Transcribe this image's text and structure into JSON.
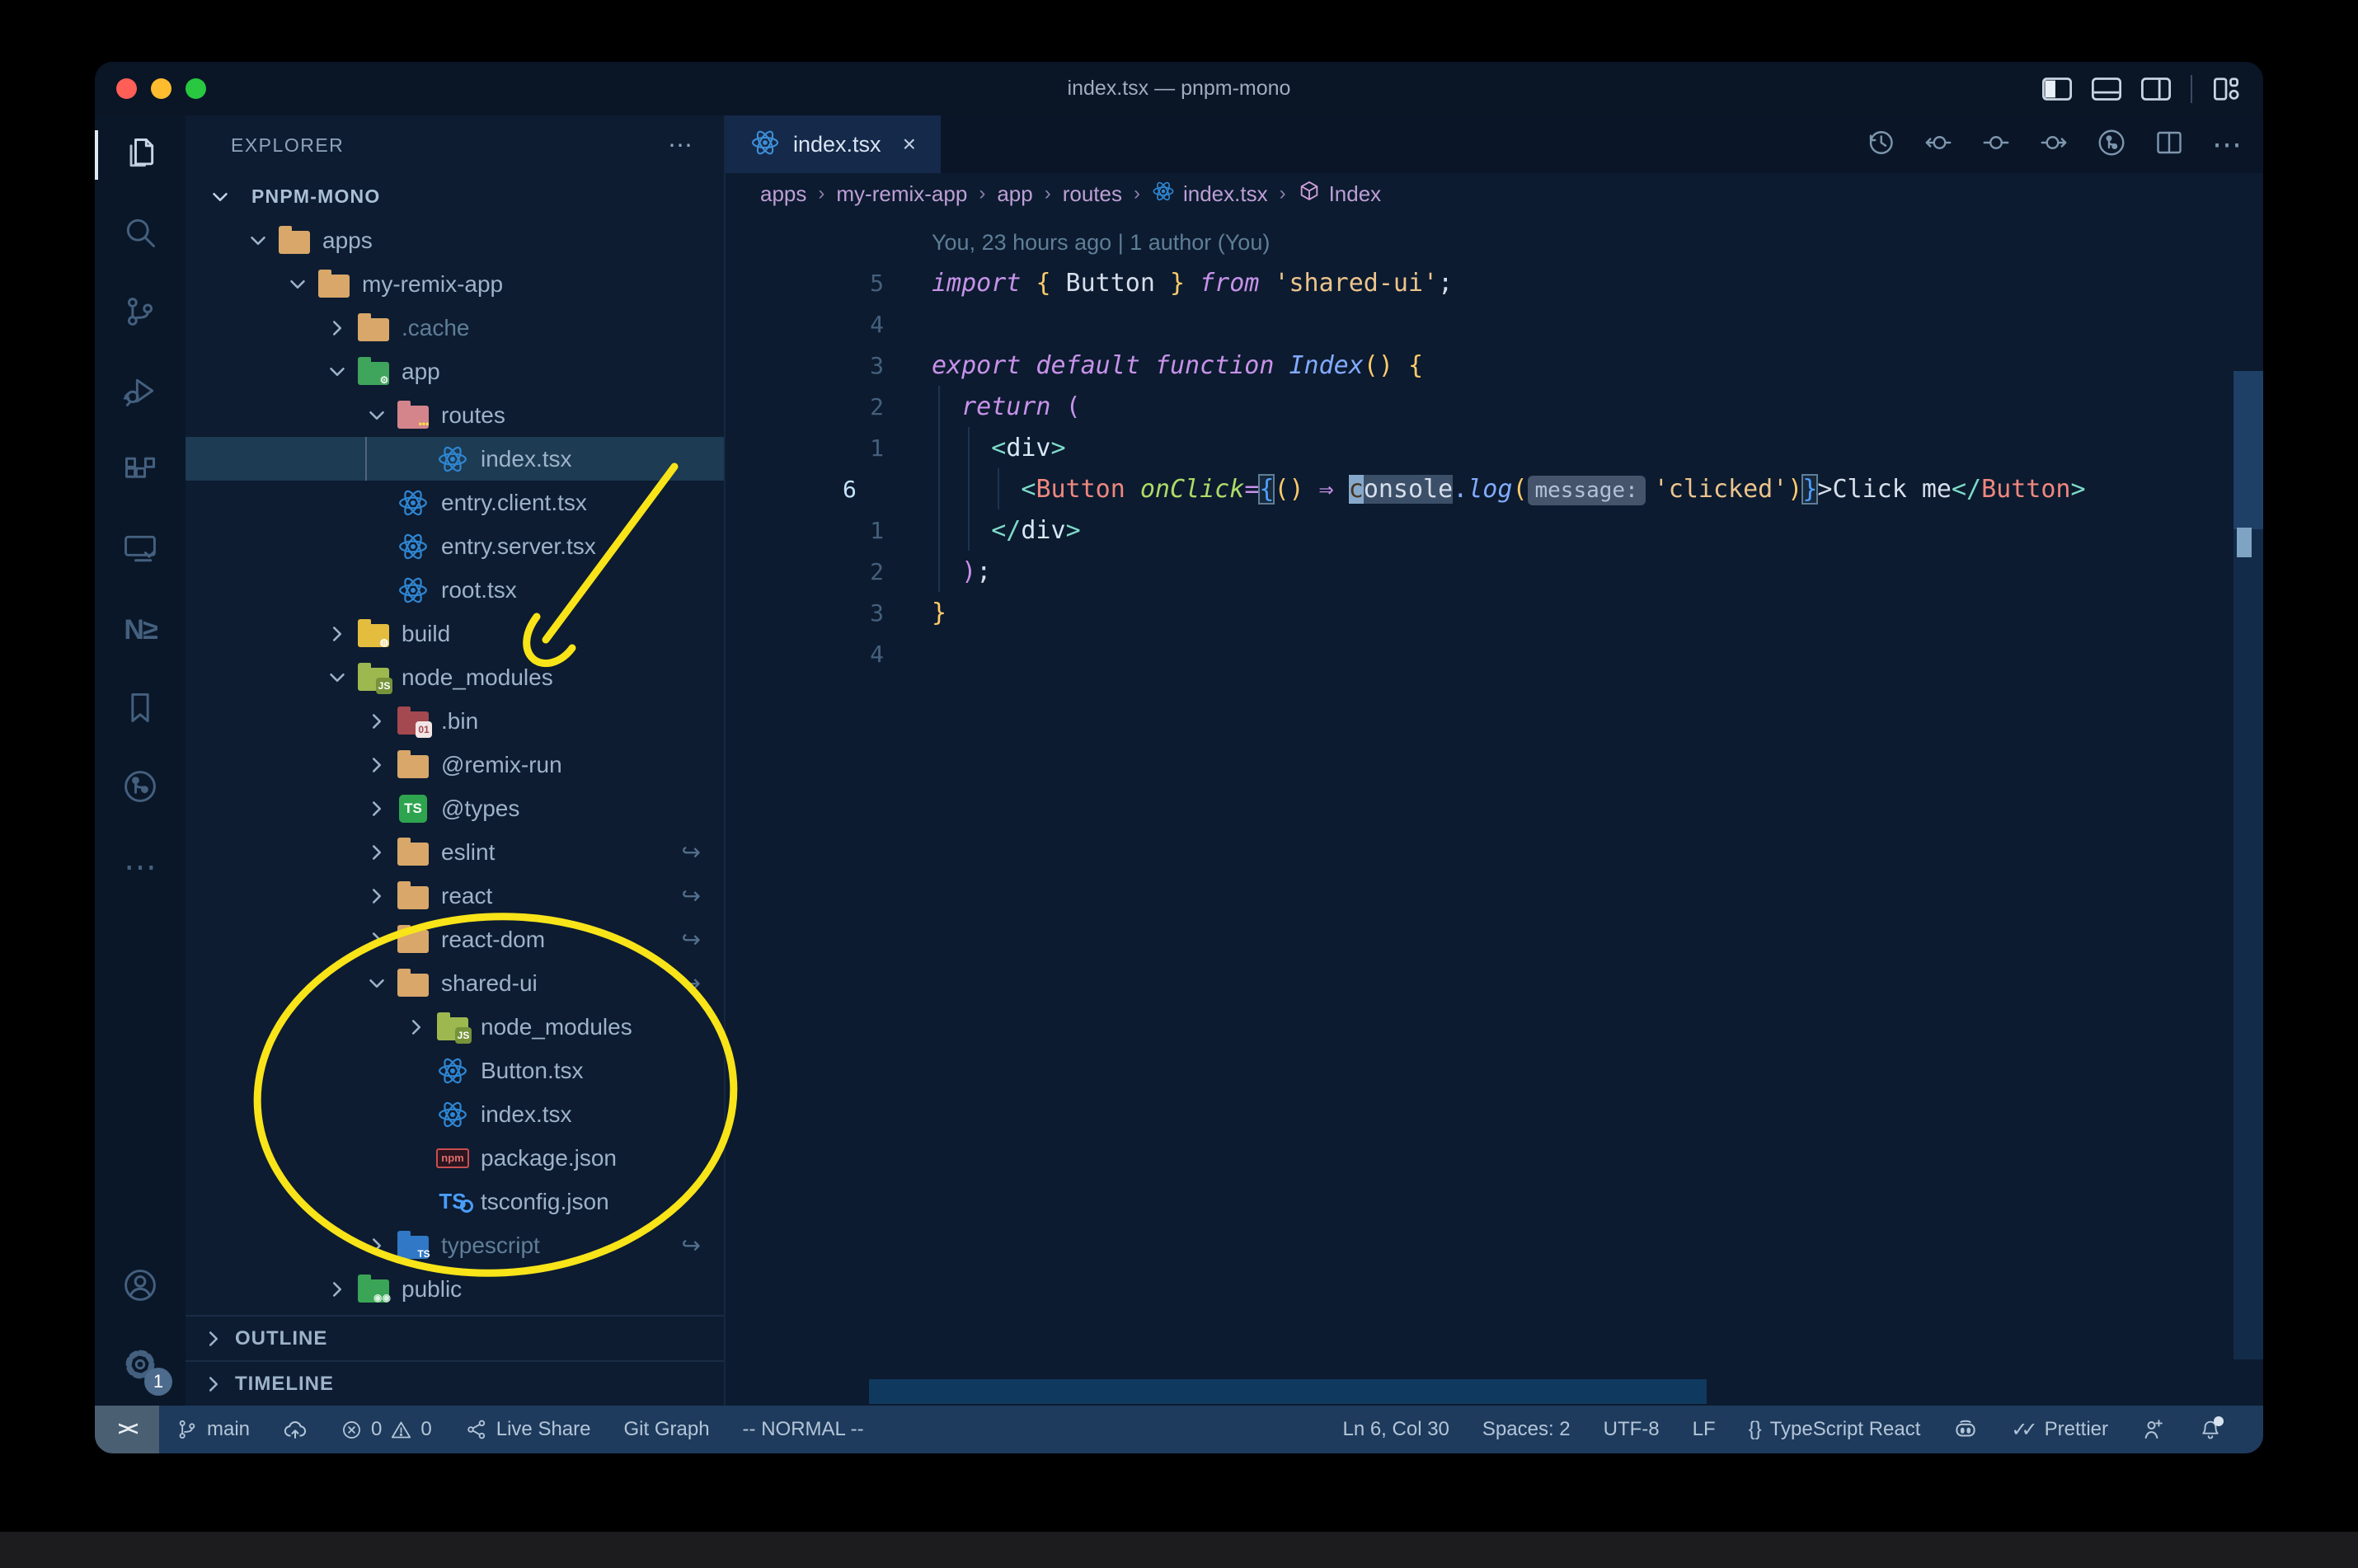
{
  "titlebar": {
    "title": "index.tsx — pnpm-mono",
    "traffic_lights": [
      "#ff5f57",
      "#febc2e",
      "#28c840"
    ],
    "layout_icons": [
      "toggle-sidebar-icon",
      "toggle-panel-icon",
      "toggle-secondary-sidebar-icon",
      "customize-layout-icon"
    ]
  },
  "activity_bar": {
    "items": [
      {
        "name": "explorer",
        "active": true
      },
      {
        "name": "search",
        "active": false
      },
      {
        "name": "source-control",
        "active": false
      },
      {
        "name": "run-debug",
        "active": false
      },
      {
        "name": "extensions",
        "active": false
      },
      {
        "name": "remote-explorer",
        "active": false
      },
      {
        "name": "nx-console",
        "active": false,
        "glyph": "N≥"
      },
      {
        "name": "bookmarks",
        "active": false
      },
      {
        "name": "git-graph",
        "active": false
      },
      {
        "name": "more-views",
        "active": false
      }
    ],
    "bottom_items": [
      {
        "name": "accounts"
      },
      {
        "name": "settings",
        "badge": "1"
      }
    ]
  },
  "explorer": {
    "header": "EXPLORER",
    "more_label": "⋯",
    "root": {
      "label": "PNPM-MONO",
      "expanded": true
    },
    "tree": [
      {
        "label": "apps",
        "depth": 0,
        "kind": "folder",
        "icon": "tan",
        "chevron": "down"
      },
      {
        "label": "my-remix-app",
        "depth": 1,
        "kind": "folder",
        "icon": "tan",
        "chevron": "down"
      },
      {
        "label": ".cache",
        "depth": 2,
        "kind": "folder",
        "icon": "tan",
        "chevron": "right",
        "dim": true
      },
      {
        "label": "app",
        "depth": 2,
        "kind": "folder",
        "icon": "green-gear",
        "chevron": "down"
      },
      {
        "label": "routes",
        "depth": 3,
        "kind": "folder",
        "icon": "routes",
        "chevron": "down"
      },
      {
        "label": "index.tsx",
        "depth": 4,
        "kind": "file",
        "icon": "react",
        "selected": true
      },
      {
        "label": "entry.client.tsx",
        "depth": 3,
        "kind": "file",
        "icon": "react"
      },
      {
        "label": "entry.server.tsx",
        "depth": 3,
        "kind": "file",
        "icon": "react"
      },
      {
        "label": "root.tsx",
        "depth": 3,
        "kind": "file",
        "icon": "react"
      },
      {
        "label": "build",
        "depth": 2,
        "kind": "folder",
        "icon": "build",
        "chevron": "right"
      },
      {
        "label": "node_modules",
        "depth": 2,
        "kind": "folder",
        "icon": "nodejs",
        "chevron": "down"
      },
      {
        "label": ".bin",
        "depth": 3,
        "kind": "folder",
        "icon": "bin",
        "chevron": "right"
      },
      {
        "label": "@remix-run",
        "depth": 3,
        "kind": "folder",
        "icon": "tan",
        "chevron": "right"
      },
      {
        "label": "@types",
        "depth": 3,
        "kind": "folder",
        "icon": "types-ts",
        "chevron": "right"
      },
      {
        "label": "eslint",
        "depth": 3,
        "kind": "folder",
        "icon": "tan",
        "chevron": "right",
        "symlink": true
      },
      {
        "label": "react",
        "depth": 3,
        "kind": "folder",
        "icon": "tan",
        "chevron": "right",
        "symlink": true
      },
      {
        "label": "react-dom",
        "depth": 3,
        "kind": "folder",
        "icon": "tan",
        "chevron": "right",
        "symlink": true
      },
      {
        "label": "shared-ui",
        "depth": 3,
        "kind": "folder",
        "icon": "tan",
        "chevron": "down",
        "symlink": true
      },
      {
        "label": "node_modules",
        "depth": 4,
        "kind": "folder",
        "icon": "nodejs",
        "chevron": "right"
      },
      {
        "label": "Button.tsx",
        "depth": 4,
        "kind": "file",
        "icon": "react"
      },
      {
        "label": "index.tsx",
        "depth": 4,
        "kind": "file",
        "icon": "react"
      },
      {
        "label": "package.json",
        "depth": 4,
        "kind": "file",
        "icon": "npm"
      },
      {
        "label": "tsconfig.json",
        "depth": 4,
        "kind": "file",
        "icon": "tsconfig"
      },
      {
        "label": "typescript",
        "depth": 3,
        "kind": "folder",
        "icon": "ts-blue",
        "chevron": "right",
        "dim": true,
        "symlink": true
      },
      {
        "label": "public",
        "depth": 2,
        "kind": "folder",
        "icon": "green-people",
        "chevron": "right"
      }
    ],
    "sections": [
      {
        "label": "OUTLINE"
      },
      {
        "label": "TIMELINE"
      }
    ]
  },
  "editor": {
    "tab": {
      "label": "index.tsx",
      "close": "×"
    },
    "toolbar_icons": [
      "file-history-icon",
      "gitlens-compare-prev-icon",
      "gitlens-heatmap-icon",
      "gitlens-compare-next-icon",
      "git-graph-icon",
      "split-editor-icon",
      "more-actions-icon"
    ],
    "breadcrumbs": [
      {
        "label": "apps"
      },
      {
        "label": "my-remix-app"
      },
      {
        "label": "app"
      },
      {
        "label": "routes"
      },
      {
        "label": "index.tsx",
        "icon": "react"
      },
      {
        "label": "Index",
        "icon": "symbol-namespace"
      }
    ],
    "blame": "You, 23 hours ago | 1 author (You)",
    "lines": [
      {
        "type": "blame"
      },
      {
        "num": "5",
        "tokens": [
          [
            "kw",
            "import"
          ],
          [
            "plain",
            " "
          ],
          [
            "py",
            "{"
          ],
          [
            "plain",
            " Button "
          ],
          [
            "py",
            "}"
          ],
          [
            "plain",
            " "
          ],
          [
            "kw",
            "from"
          ],
          [
            "plain",
            " "
          ],
          [
            "str",
            "'shared-ui'"
          ],
          [
            "plain",
            ";"
          ]
        ]
      },
      {
        "num": "4",
        "tokens": []
      },
      {
        "num": "3",
        "tokens": [
          [
            "kw",
            "export default function "
          ],
          [
            "fn",
            "Index"
          ],
          [
            "py",
            "()"
          ],
          [
            "plain",
            " "
          ],
          [
            "py",
            "{"
          ]
        ]
      },
      {
        "num": "2",
        "tokens": [
          [
            "plain",
            "  "
          ],
          [
            "kw",
            "return"
          ],
          [
            "plain",
            " "
          ],
          [
            "pp",
            "("
          ]
        ]
      },
      {
        "num": "1",
        "tokens": [
          [
            "plain",
            "    "
          ],
          [
            "br",
            "<"
          ],
          [
            "tag",
            "div"
          ],
          [
            "br",
            ">"
          ]
        ]
      },
      {
        "num": "6",
        "cur": true,
        "tokens": [
          [
            "plain",
            "      "
          ],
          [
            "br",
            "<"
          ],
          [
            "comp",
            "Button"
          ],
          [
            "plain",
            " "
          ],
          [
            "attr",
            "onClick"
          ],
          [
            "op",
            "="
          ],
          [
            "boxb",
            "{"
          ],
          [
            "py",
            "()"
          ],
          [
            "plain",
            " "
          ],
          [
            "op",
            "⇒"
          ],
          [
            "plain",
            " "
          ],
          [
            "cursor",
            "c"
          ],
          [
            "hl",
            "onsole"
          ],
          [
            "dot",
            "."
          ],
          [
            "fn",
            "log"
          ],
          [
            "py",
            "("
          ],
          [
            "hint",
            "message:"
          ],
          [
            "str",
            "'clicked'"
          ],
          [
            "py",
            ")"
          ],
          [
            "boxb",
            "}"
          ],
          [
            "plain",
            ">Click me"
          ],
          [
            "br",
            "</"
          ],
          [
            "comp",
            "Button"
          ],
          [
            "br",
            ">"
          ]
        ]
      },
      {
        "num": "1",
        "tokens": [
          [
            "plain",
            "    "
          ],
          [
            "br",
            "</"
          ],
          [
            "tag",
            "div"
          ],
          [
            "br",
            ">"
          ]
        ]
      },
      {
        "num": "2",
        "tokens": [
          [
            "plain",
            "  "
          ],
          [
            "pp",
            ")"
          ],
          [
            "plain",
            ";"
          ]
        ]
      },
      {
        "num": "3",
        "tokens": [
          [
            "py",
            "}"
          ]
        ]
      },
      {
        "num": "4",
        "tokens": []
      }
    ]
  },
  "status_bar": {
    "left": [
      {
        "name": "remote-indicator",
        "glyph": "><"
      },
      {
        "name": "git-branch",
        "icon": "branch",
        "label": "main"
      },
      {
        "name": "sync",
        "icon": "cloud-upload",
        "label": ""
      },
      {
        "name": "problems",
        "icon": "errors-warnings",
        "label_errors": "0",
        "label_warnings": "0"
      },
      {
        "name": "live-share",
        "icon": "share",
        "label": "Live Share"
      },
      {
        "name": "git-graph",
        "label": "Git Graph"
      },
      {
        "name": "vim-mode",
        "label": "-- NORMAL --"
      }
    ],
    "right": [
      {
        "name": "cursor-position",
        "label": "Ln 6, Col 30"
      },
      {
        "name": "indentation",
        "label": "Spaces: 2"
      },
      {
        "name": "encoding",
        "label": "UTF-8"
      },
      {
        "name": "eol",
        "label": "LF"
      },
      {
        "name": "language-mode",
        "icon_glyph": "{}",
        "label": "TypeScript React"
      },
      {
        "name": "copilot",
        "icon": "copilot",
        "label": ""
      },
      {
        "name": "prettier",
        "icon_glyph": "✓✓",
        "label": "Prettier"
      },
      {
        "name": "feedback",
        "icon": "person",
        "label": ""
      },
      {
        "name": "notifications",
        "icon": "bell",
        "label": ""
      }
    ]
  },
  "annotations": {
    "color": "#f8e418",
    "shapes": [
      {
        "type": "arrow",
        "note": "points-to-node-modules"
      },
      {
        "type": "ellipse",
        "note": "circles-shared-ui-package"
      }
    ]
  },
  "colors": {
    "editor_bg": "#0c1b2f",
    "sidebar_bg": "#0d1c31",
    "statusbar_bg": "#1e3b5d",
    "selection_bg": "#1d3b53",
    "keyword": "#c792ea",
    "string": "#ecc48d",
    "function": "#82aaff",
    "component_tag": "#f0877f",
    "attribute": "#addb67",
    "annotation_yellow": "#f8e418"
  }
}
